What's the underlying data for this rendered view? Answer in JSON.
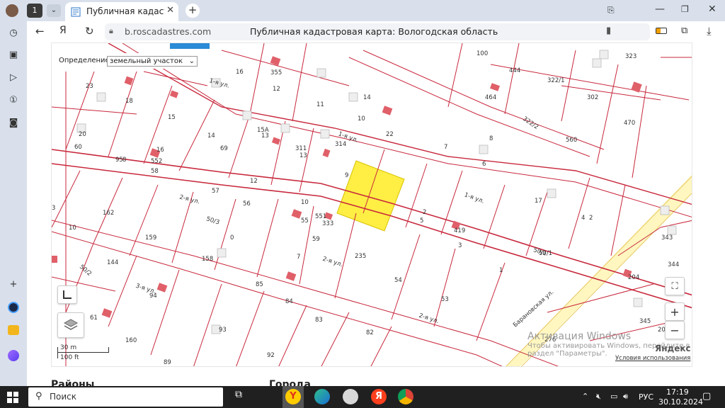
{
  "browser": {
    "tab_count": "1",
    "tab_title": "Публичная кадастрова",
    "url": "b.roscadastres.com",
    "page_title": "Публичная кадастровая карта: Вологодская область"
  },
  "map_panel": {
    "definition_label": "Определение:",
    "definition_value": "земельный участок",
    "scale_m": "30 m",
    "scale_ft": "100 ft",
    "yandex_logo": "Яндекс",
    "terms_link": "Условия использования",
    "zoom_in": "+",
    "zoom_out": "−"
  },
  "streets": [
    "1-я ул.",
    "1-я ул.",
    "1-я ул.",
    "2-я ул.",
    "2-я ул.",
    "2-я ул.",
    "3-я ул.",
    "Барановская ул.",
    "50/1",
    "50/2",
    "50/3",
    "322/2"
  ],
  "parcels": [
    "23",
    "18",
    "16",
    "12",
    "11",
    "14",
    "10",
    "22",
    "7",
    "8",
    "6",
    "464",
    "444",
    "322/1",
    "302",
    "470",
    "100",
    "323",
    "355",
    "14",
    "15",
    "20",
    "60",
    "95",
    "8",
    "16",
    "58",
    "552",
    "57",
    "12",
    "56",
    "55",
    "551",
    "9",
    "13",
    "15А",
    "311",
    "69",
    "13",
    "314",
    "17",
    "4",
    "2",
    "5",
    "3",
    "419",
    "1",
    "50/1",
    "162",
    "159",
    "158",
    "144",
    "94",
    "85",
    "84",
    "83",
    "82",
    "235",
    "54",
    "53",
    "59",
    "333",
    "10",
    "343",
    "204",
    "205",
    "276",
    "93",
    "92",
    "89",
    "61",
    "160",
    "10",
    "3",
    "560",
    "0",
    "7",
    "345",
    "2",
    "344"
  ],
  "watermark": {
    "line1": "Активация Windows",
    "line2": "Чтобы активировать Windows, перейдите в",
    "line3": "раздел \"Параметры\"."
  },
  "page_below": {
    "col1": "Районы",
    "col2": "Города"
  },
  "taskbar": {
    "search": "Поиск",
    "lang": "РУС",
    "time": "17:19",
    "date": "30.10.2024"
  },
  "colors": {
    "parcel_line": "#c8283c",
    "highlight": "#ffee44",
    "building": "#e0606a",
    "road": "#fff6c0"
  }
}
